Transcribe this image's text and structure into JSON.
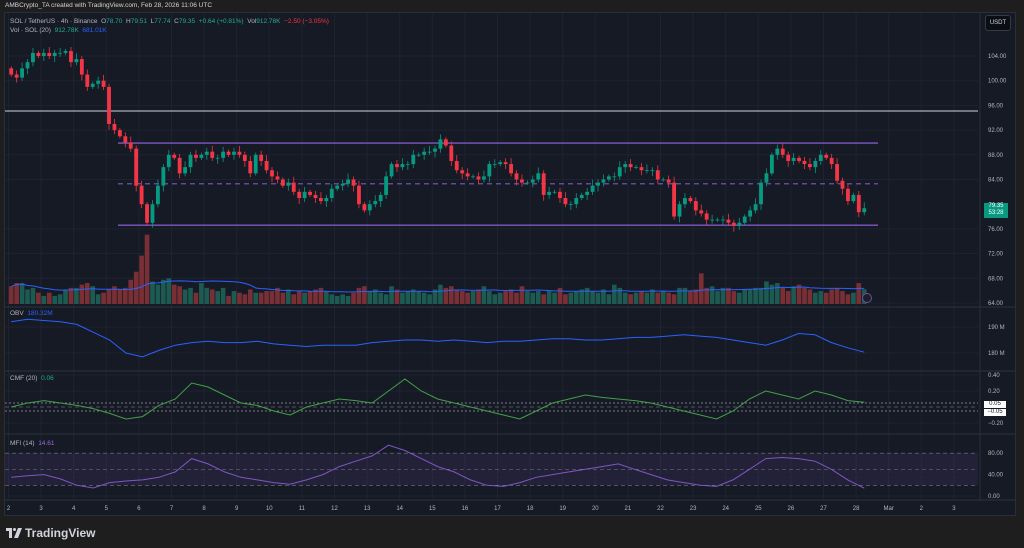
{
  "credit": "AMBCrypto_TA created with TradingView.com, Feb 28, 2026 11:06 UTC",
  "legend": {
    "symbol": "SOL / TetherUS · 4h · Binance",
    "o_label": "O",
    "o": "78.70",
    "h_label": "H",
    "h": "79.51",
    "l_label": "L",
    "l": "77.74",
    "c_label": "C",
    "c": "79.35",
    "change": "+0.64 (+0.81%)",
    "vol_label": "Vol",
    "vol": "912.78K",
    "vol_change": "−2.50 (−3.05%)",
    "vol_ind": "Vol · SOL (20)",
    "vol_ind_v1": "912.78K",
    "vol_ind_v2": "681.01K"
  },
  "currency_button": "USDT",
  "last_price": {
    "price": "79.35",
    "countdown": "53:28"
  },
  "colors": {
    "up": "#089981",
    "down": "#f23645",
    "range": "#7e57c2",
    "obv": "#2962ff",
    "cmf": "#43a047",
    "mfi": "#7e57c2",
    "bg": "#161a25"
  },
  "logo": "TradingView",
  "chart_data": {
    "type": "candlestick",
    "title": "SOL / TetherUS · 4h · Binance",
    "start_day": 2,
    "candles_per_day": 6,
    "closes": [
      101,
      100.5,
      102,
      103,
      104.5,
      104,
      104.5,
      104,
      104.5,
      104.5,
      104.8,
      103,
      103.5,
      101,
      99,
      99.5,
      100,
      99,
      93,
      92,
      91,
      90,
      89,
      83,
      80,
      77,
      80,
      83,
      86,
      88,
      87.5,
      85,
      86,
      88,
      87.5,
      88,
      88.5,
      87.5,
      87.5,
      88.5,
      88,
      88.5,
      88,
      87,
      85,
      88,
      87,
      85.5,
      84.5,
      84,
      83,
      83.5,
      82,
      81,
      82,
      81.5,
      81,
      80.5,
      81,
      82.5,
      83,
      83.3,
      84,
      83,
      80,
      79,
      80,
      80.5,
      81.5,
      84.5,
      86.5,
      86,
      86.5,
      86.5,
      88,
      88,
      88.5,
      88.5,
      89,
      90.5,
      89.5,
      87,
      85.5,
      85,
      84.5,
      84.5,
      84,
      84.5,
      86.5,
      86.5,
      86.8,
      86.5,
      85,
      84,
      83.5,
      83.5,
      84,
      85,
      81.5,
      82,
      82,
      81,
      80,
      80,
      81,
      81.5,
      82,
      83,
      83.5,
      84,
      84.5,
      84.5,
      86,
      86.5,
      86,
      86,
      85.5,
      85.5,
      85.5,
      84,
      84,
      83.5,
      78,
      80,
      81,
      80.5,
      79,
      78.5,
      77.5,
      77.5,
      77.5,
      77.5,
      77,
      76.5,
      77,
      78,
      79,
      80,
      83.5,
      85,
      88,
      89,
      88,
      87,
      87.5,
      87,
      86.5,
      86,
      87,
      88,
      87.5,
      86.5,
      83.8,
      82.5,
      80.5,
      81.5,
      78.7,
      79.35
    ],
    "first_open": 102,
    "volume_k": [
      1100,
      1300,
      1300,
      900,
      1000,
      700,
      500,
      700,
      500,
      600,
      900,
      1000,
      1000,
      1200,
      1300,
      1100,
      600,
      700,
      900,
      1100,
      900,
      1000,
      1500,
      2000,
      3000,
      4300,
      1400,
      1200,
      1500,
      1600,
      1200,
      1100,
      900,
      1000,
      700,
      1300,
      1000,
      900,
      800,
      1000,
      500,
      800,
      700,
      600,
      900,
      700,
      700,
      800,
      800,
      1000,
      700,
      900,
      600,
      800,
      700,
      800,
      900,
      1000,
      800,
      600,
      500,
      600,
      500,
      700,
      1000,
      1100,
      800,
      900,
      700,
      600,
      1100,
      900,
      700,
      800,
      900,
      800,
      700,
      600,
      900,
      1200,
      1000,
      1100,
      900,
      800,
      700,
      800,
      900,
      1100,
      800,
      600,
      700,
      800,
      900,
      700,
      1100,
      800,
      700,
      800,
      600,
      800,
      700,
      1000,
      600,
      700,
      800,
      900,
      1000,
      800,
      700,
      900,
      600,
      1200,
      1000,
      700,
      600,
      700,
      800,
      700,
      900,
      700,
      800,
      700,
      600,
      1000,
      1000,
      800,
      900,
      1900,
      1000,
      1100,
      800,
      1000,
      1000,
      800,
      700,
      900,
      900,
      1000,
      1000,
      1400,
      1200,
      1300,
      1000,
      800,
      1100,
      1200,
      1000,
      900,
      700,
      800,
      700,
      900,
      1000,
      800,
      600,
      700,
      1300,
      913
    ],
    "levels": {
      "resistance": 89.9,
      "midline": 83.3,
      "support": 76.6,
      "prior_level": 95.1
    },
    "price_ticks": [
      "104.00",
      "100.00",
      "96.00",
      "92.00",
      "88.00",
      "84.00",
      "76.00",
      "72.00",
      "68.00",
      "64.00"
    ],
    "price_tick_values": [
      104,
      100,
      96,
      92,
      88,
      84,
      76,
      72,
      68,
      64
    ],
    "x_ticks": [
      "2",
      "3",
      "4",
      "5",
      "6",
      "7",
      "8",
      "9",
      "10",
      "11",
      "12",
      "13",
      "14",
      "15",
      "16",
      "17",
      "18",
      "19",
      "20",
      "21",
      "22",
      "23",
      "24",
      "25",
      "26",
      "27",
      "28",
      "Mar",
      "2",
      "3"
    ],
    "indicators": {
      "obv": {
        "label": "OBV",
        "value": "180.32M",
        "ticks": [
          "190 M",
          "180 M"
        ],
        "tick_values": [
          190,
          180
        ],
        "values": [
          192,
          193,
          192.5,
          192,
          191,
          188,
          185,
          180,
          178.5,
          181,
          183,
          184,
          184.5,
          184,
          184,
          184.5,
          183.5,
          183,
          182.5,
          183,
          183,
          183,
          184,
          184.5,
          185,
          185,
          184.5,
          185,
          184.5,
          184,
          184.5,
          184.5,
          185,
          185.5,
          185.5,
          185,
          185,
          185.5,
          186,
          186,
          186.5,
          187,
          186.5,
          186,
          185,
          184,
          183,
          185,
          187.5,
          187,
          184,
          182,
          180.3
        ]
      },
      "cmf": {
        "label": "CMF (20)",
        "value": "0.06",
        "ticks": [
          "0.40",
          "0.20",
          "−0.20"
        ],
        "tick_values": [
          0.4,
          0.2,
          -0.2
        ],
        "bands": [
          "0.05",
          "−0.05"
        ],
        "values": [
          0,
          0.05,
          0.08,
          0.05,
          0.02,
          -0.02,
          -0.08,
          -0.15,
          -0.12,
          0.02,
          0.1,
          0.3,
          0.25,
          0.15,
          0.05,
          0.02,
          -0.05,
          -0.1,
          0,
          0.05,
          0.1,
          0.08,
          0.05,
          0.2,
          0.35,
          0.2,
          0.1,
          0.05,
          0,
          -0.05,
          -0.1,
          -0.15,
          -0.05,
          0.05,
          0.1,
          0.15,
          0.12,
          0.1,
          0.08,
          0.05,
          0,
          -0.05,
          -0.1,
          -0.15,
          -0.05,
          0.1,
          0.2,
          0.15,
          0.1,
          0.2,
          0.15,
          0.08,
          0.06
        ]
      },
      "mfi": {
        "label": "MFI (14)",
        "value": "14.61",
        "ticks": [
          "80.00",
          "40.00",
          "0.00"
        ],
        "tick_values": [
          80,
          40,
          0
        ],
        "values": [
          35,
          38,
          40,
          32,
          20,
          15,
          25,
          28,
          30,
          35,
          45,
          70,
          60,
          45,
          35,
          30,
          25,
          22,
          30,
          40,
          55,
          65,
          75,
          95,
          85,
          70,
          55,
          45,
          30,
          20,
          18,
          25,
          35,
          40,
          45,
          50,
          55,
          60,
          50,
          40,
          30,
          25,
          20,
          18,
          30,
          50,
          70,
          72,
          70,
          65,
          50,
          30,
          14.61
        ]
      }
    }
  }
}
